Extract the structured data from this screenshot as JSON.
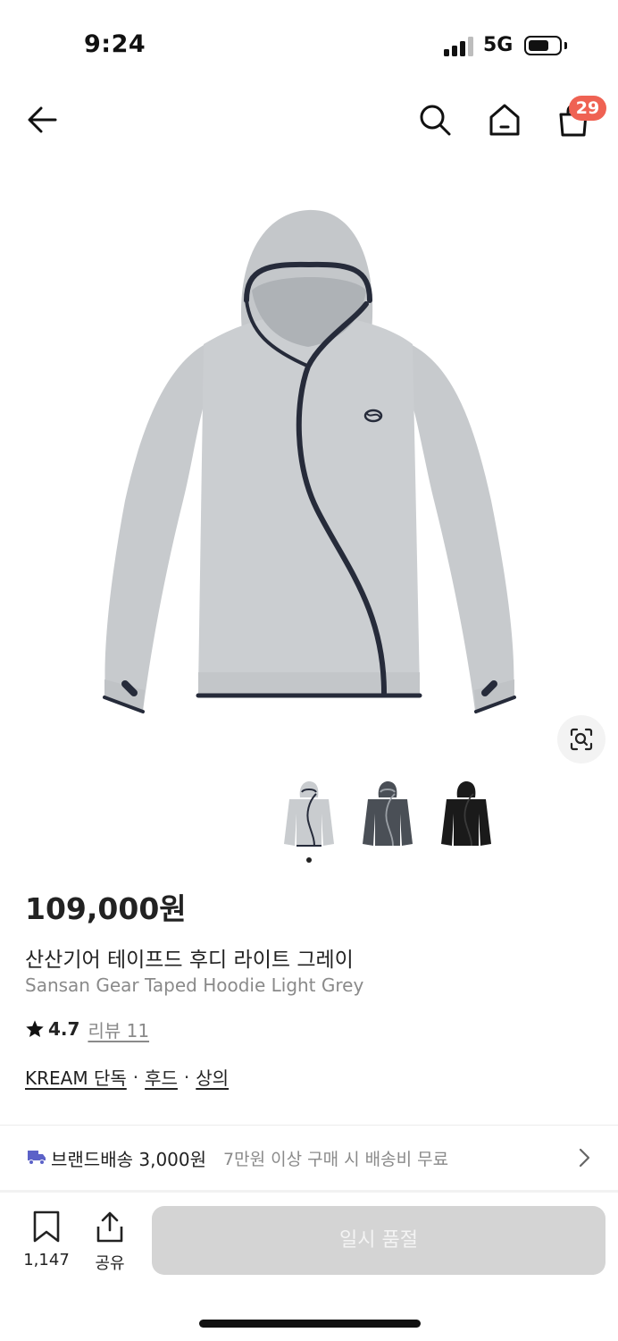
{
  "status_bar": {
    "time": "9:24",
    "network": "5G"
  },
  "nav": {
    "cart_count": "29"
  },
  "product": {
    "price": "109,000원",
    "name_ko": "산산기어 테이프드 후디 라이트 그레이",
    "name_en": "Sansan Gear Taped Hoodie Light Grey",
    "rating": "4.7",
    "review_label": "리뷰 11",
    "tags": [
      "KREAM 단독",
      "후드",
      "상의"
    ],
    "tag_separator": "·",
    "colorways": [
      "light-grey",
      "charcoal",
      "black"
    ],
    "selected_colorway_index": 0,
    "colors": {
      "light_grey": "#c9cccf",
      "charcoal": "#4a4f56",
      "black": "#1a1a1a",
      "tape": "#262b3a"
    }
  },
  "shipping": {
    "title": "브랜드배송 3,000원",
    "description": "7만원 이상 구매 시 배송비 무료",
    "icon": "truck-icon",
    "icon_color": "#5c62c8"
  },
  "actions": {
    "bookmark_count": "1,147",
    "share_label": "공유",
    "soldout_label": "일시 품절"
  },
  "theme": {
    "badge_color": "#ef6253",
    "soldout_bg": "#d4d4d4"
  }
}
